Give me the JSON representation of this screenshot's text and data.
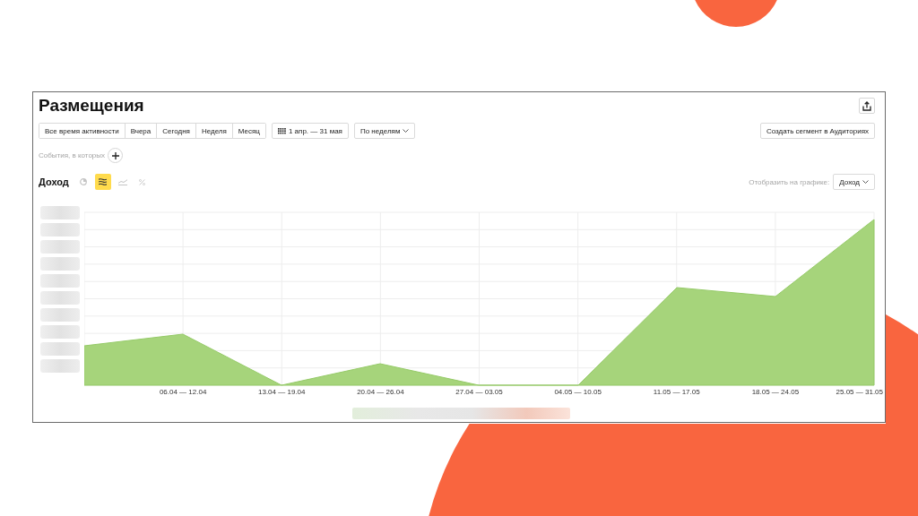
{
  "title": "Размещения",
  "periods": [
    {
      "label": "Все время активности",
      "selected": false
    },
    {
      "label": "Вчера",
      "selected": false
    },
    {
      "label": "Сегодня",
      "selected": false
    },
    {
      "label": "Неделя",
      "selected": false
    },
    {
      "label": "Месяц",
      "selected": false
    }
  ],
  "date_range": "1 апр. — 31 мая",
  "grouping": "По неделям",
  "segment_button": "Создать сегмент в Аудиториях",
  "filter": {
    "label": "События, в которых"
  },
  "metric": {
    "title": "Доход",
    "chart_modes": [
      {
        "kind": "pie",
        "selected": false
      },
      {
        "kind": "stacked",
        "selected": true
      },
      {
        "kind": "line",
        "selected": false
      },
      {
        "kind": "percent",
        "selected": false
      }
    ],
    "display_label": "Отобразить на графике:",
    "display_value": "Доход"
  },
  "chart": {
    "x_labels": [
      "06.04 — 12.04",
      "13.04 — 19.04",
      "20.04 — 26.04",
      "27.04 — 03.05",
      "04.05 — 10.05",
      "11.05 — 17.05",
      "18.05 — 24.05",
      "25.05 — 31.05"
    ]
  }
}
